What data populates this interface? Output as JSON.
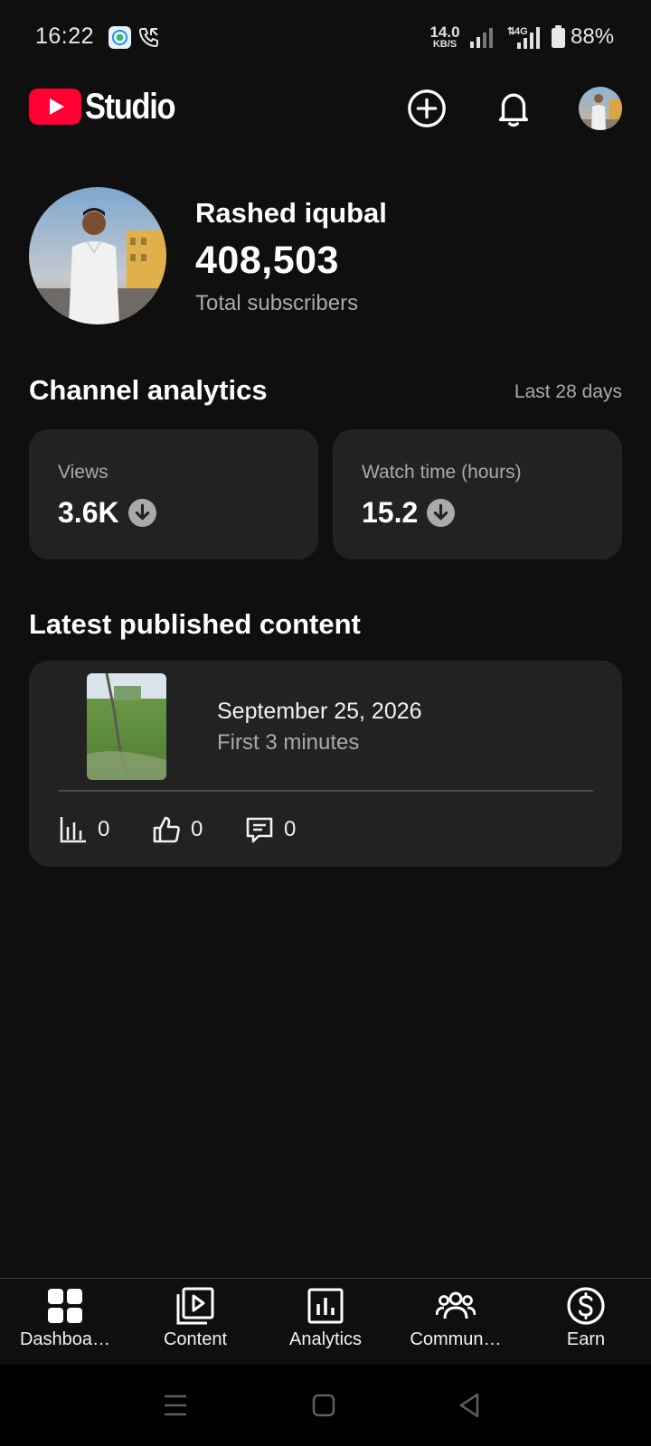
{
  "status_bar": {
    "time": "16:22",
    "net_speed_value": "14.0",
    "net_speed_unit": "KB/S",
    "network_type": "4G",
    "battery": "88%"
  },
  "header": {
    "logo_text": "Studio",
    "icons": [
      "youtube-logo-icon",
      "create-plus-icon",
      "notifications-bell-icon",
      "account-avatar"
    ]
  },
  "channel": {
    "name": "Rashed iqubal",
    "subscribers": "408,503",
    "subscribers_label": "Total subscribers"
  },
  "analytics": {
    "title": "Channel analytics",
    "period": "Last 28 days",
    "metrics": [
      {
        "label": "Views",
        "value": "3.6K",
        "trend": "down"
      },
      {
        "label": "Watch time (hours)",
        "value": "15.2",
        "trend": "down"
      }
    ]
  },
  "latest": {
    "title": "Latest published content",
    "date": "September 25, 2026",
    "subtitle": "First 3 minutes",
    "stats": [
      {
        "icon": "views-bar-chart-icon",
        "value": "0"
      },
      {
        "icon": "thumbs-up-icon",
        "value": "0"
      },
      {
        "icon": "comment-icon",
        "value": "0"
      }
    ]
  },
  "bottom_nav": [
    {
      "label": "Dashboa…",
      "icon": "dashboard-grid-icon"
    },
    {
      "label": "Content",
      "icon": "content-play-icon"
    },
    {
      "label": "Analytics",
      "icon": "analytics-chart-icon"
    },
    {
      "label": "Commun…",
      "icon": "community-people-icon"
    },
    {
      "label": "Earn",
      "icon": "earn-dollar-icon"
    }
  ],
  "colors": {
    "background": "#0f0f0f",
    "card": "#222222",
    "youtube_red": "#ff0033",
    "secondary_text": "#aaaaaa"
  }
}
